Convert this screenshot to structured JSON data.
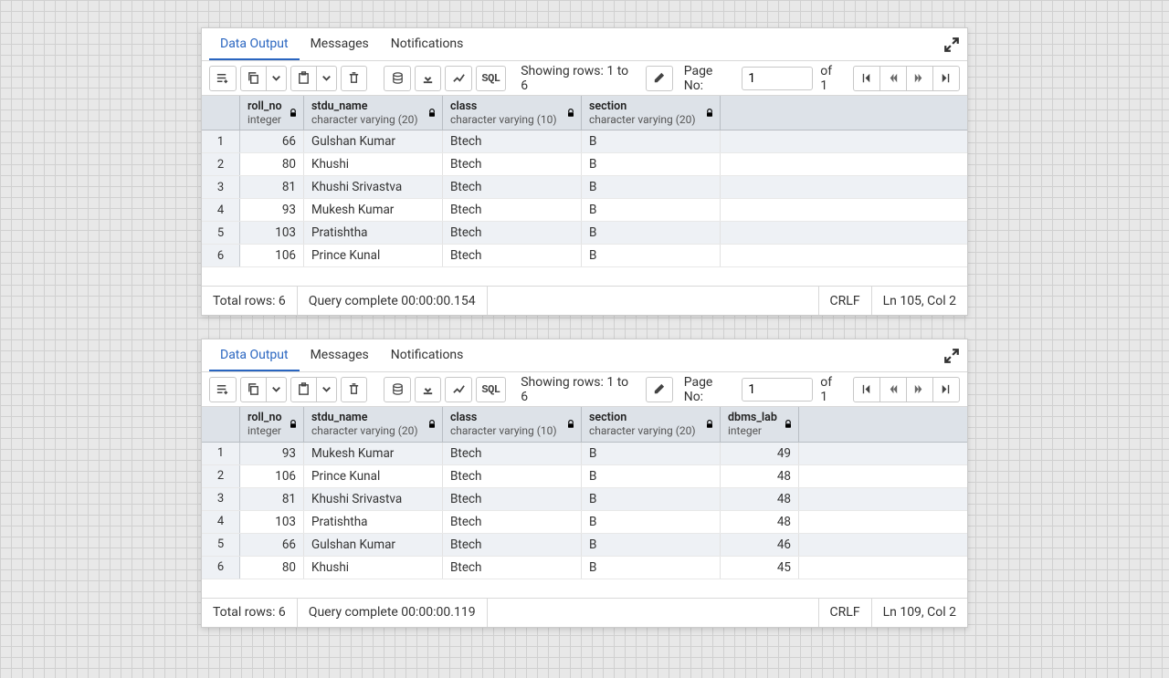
{
  "panels": [
    {
      "tabs": [
        "Data Output",
        "Messages",
        "Notifications"
      ],
      "active_tab": 0,
      "rows_text": "Showing rows: 1 to 6",
      "page_label": "Page No:",
      "page_value": "1",
      "of_text": "of 1",
      "status": {
        "total": "Total rows: 6",
        "query": "Query complete 00:00:00.154",
        "lineend": "CRLF",
        "cursor": "Ln 105, Col 2"
      },
      "columns": [
        {
          "name": "roll_no",
          "type": "integer",
          "w": "col-roll",
          "num": true
        },
        {
          "name": "stdu_name",
          "type": "character varying (20)",
          "w": "col-name"
        },
        {
          "name": "class",
          "type": "character varying (10)",
          "w": "col-class"
        },
        {
          "name": "section",
          "type": "character varying (20)",
          "w": "col-section"
        }
      ],
      "rows": [
        [
          "66",
          "Gulshan Kumar",
          "Btech",
          "B"
        ],
        [
          "80",
          "Khushi",
          "Btech",
          "B"
        ],
        [
          "81",
          "Khushi Srivastva",
          "Btech",
          "B"
        ],
        [
          "93",
          "Mukesh Kumar",
          "Btech",
          "B"
        ],
        [
          "103",
          "Pratishtha",
          "Btech",
          "B"
        ],
        [
          "106",
          "Prince Kunal",
          "Btech",
          "B"
        ]
      ]
    },
    {
      "tabs": [
        "Data Output",
        "Messages",
        "Notifications"
      ],
      "active_tab": 0,
      "rows_text": "Showing rows: 1 to 6",
      "page_label": "Page No:",
      "page_value": "1",
      "of_text": "of 1",
      "status": {
        "total": "Total rows: 6",
        "query": "Query complete 00:00:00.119",
        "lineend": "CRLF",
        "cursor": "Ln 109, Col 2"
      },
      "columns": [
        {
          "name": "roll_no",
          "type": "integer",
          "w": "col-roll",
          "num": true
        },
        {
          "name": "stdu_name",
          "type": "character varying (20)",
          "w": "col-name"
        },
        {
          "name": "class",
          "type": "character varying (10)",
          "w": "col-class"
        },
        {
          "name": "section",
          "type": "character varying (20)",
          "w": "col-section"
        },
        {
          "name": "dbms_lab",
          "type": "integer",
          "w": "col-dbms",
          "num": true
        }
      ],
      "rows": [
        [
          "93",
          "Mukesh Kumar",
          "Btech",
          "B",
          "49"
        ],
        [
          "106",
          "Prince Kunal",
          "Btech",
          "B",
          "48"
        ],
        [
          "81",
          "Khushi Srivastva",
          "Btech",
          "B",
          "48"
        ],
        [
          "103",
          "Pratishtha",
          "Btech",
          "B",
          "48"
        ],
        [
          "66",
          "Gulshan Kumar",
          "Btech",
          "B",
          "46"
        ],
        [
          "80",
          "Khushi",
          "Btech",
          "B",
          "45"
        ]
      ]
    }
  ]
}
